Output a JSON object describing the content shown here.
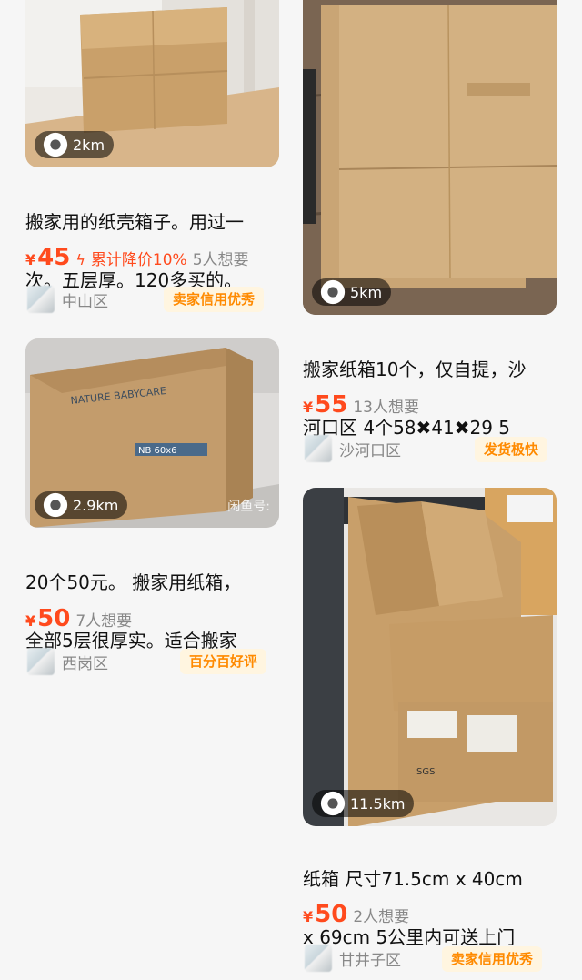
{
  "listings": [
    {
      "distance": "2km",
      "title": "搬家用的纸壳箱子。用过一次。五层厚。120多买的。",
      "title_lines": [
        "搬家用的纸壳箱子。用过一",
        "次。五层厚。120多买的。"
      ],
      "currency": "¥",
      "price": "45",
      "promo": "累计降价10%",
      "want": "5人想要",
      "area": "中山区",
      "badge": "卖家信用优秀"
    },
    {
      "distance": "5km",
      "title_lines": [
        "搬家纸箱10个，仅自提，沙",
        "河口区 4个58✖41✖29  5"
      ],
      "currency": "¥",
      "price": "55",
      "want": "13人想要",
      "area": "沙河口区",
      "badge": "发货极快"
    },
    {
      "distance": "2.9km",
      "watermark": "闲鱼号:",
      "box_text": "NATURE BABYCARE",
      "box_size": "NB 60x6",
      "title_lines": [
        "20个50元。 搬家用纸箱，",
        "全部5层很厚实。适合搬家"
      ],
      "currency": "¥",
      "price": "50",
      "want": "7人想要",
      "area": "西岗区",
      "badge": "百分百好评"
    },
    {
      "distance": "11.5km",
      "box_label": "SGS",
      "title_lines": [
        "纸箱 尺寸71.5cm x 40cm",
        "x 69cm 5公里内可送上门"
      ],
      "currency": "¥",
      "price": "50",
      "want": "2人想要",
      "area": "甘井子区",
      "badge": "卖家信用优秀"
    }
  ],
  "colors": {
    "price": "#ff4a1d",
    "badge_text": "#ff8a00",
    "badge_bg": "#fff5e0"
  },
  "icons": {
    "distance": "location-pin-icon",
    "promo": "lightning-icon"
  }
}
